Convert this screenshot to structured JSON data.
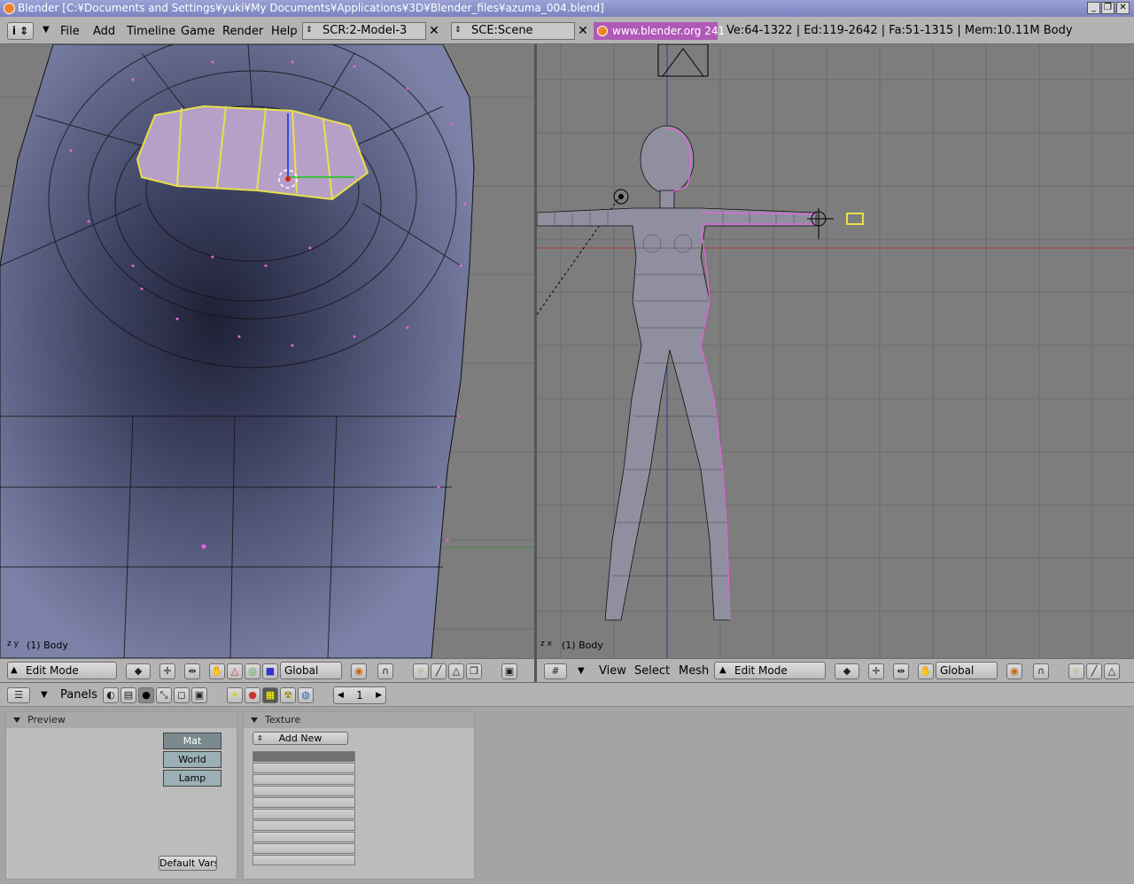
{
  "window": {
    "title": "Blender [C:¥Documents and Settings¥yuki¥My Documents¥Applications¥3D¥Blender_files¥azuma_004.blend]"
  },
  "topbar": {
    "menus": [
      "File",
      "Add",
      "Timeline",
      "Game",
      "Render",
      "Help"
    ],
    "screen_field": "SCR:2-Model-3",
    "scene_field": "SCE:Scene",
    "link": "www.blender.org 241",
    "stats": "Ve:64-1322 | Ed:119-2642 | Fa:51-1315 | Mem:10.11M Body"
  },
  "viewport_left": {
    "label": "(1) Body"
  },
  "viewport_right": {
    "label": "(1) Body"
  },
  "header_left": {
    "mode": "Edit Mode",
    "orientation": "Global"
  },
  "header_right": {
    "menus": [
      "View",
      "Select",
      "Mesh"
    ],
    "mode": "Edit Mode",
    "orientation": "Global"
  },
  "buttons_header": {
    "panels_label": "Panels",
    "frame": "1"
  },
  "preview_panel": {
    "title": "Preview",
    "tabs": [
      "Mat",
      "World",
      "Lamp"
    ],
    "default_vars": "Default Vars"
  },
  "texture_panel": {
    "title": "Texture",
    "add_new": "Add New"
  },
  "colors": {
    "mesh_face": "#5a5f80",
    "selected_edge": "#e8e04a",
    "vertex": "#e866e0",
    "link_bg": "#b05ab8"
  }
}
